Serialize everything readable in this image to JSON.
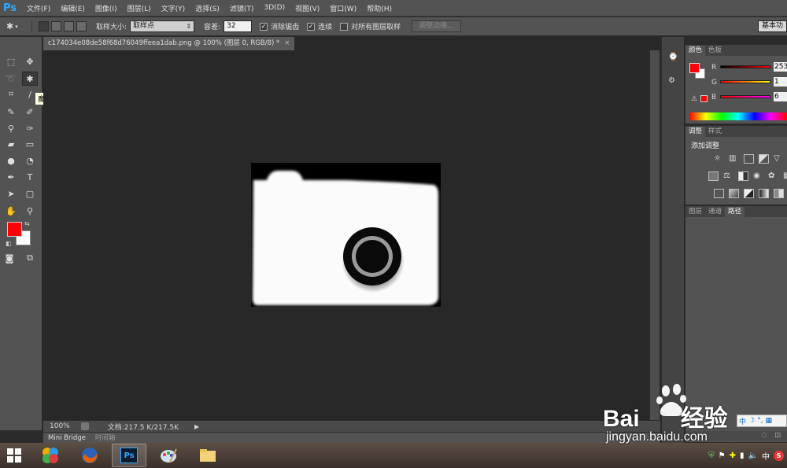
{
  "app": {
    "logo": "Ps"
  },
  "menu": [
    "文件(F)",
    "编辑(E)",
    "图像(I)",
    "图层(L)",
    "文字(Y)",
    "选择(S)",
    "滤镜(T)",
    "3D(D)",
    "视图(V)",
    "窗口(W)",
    "帮助(H)"
  ],
  "options": {
    "sample_size_label": "取样大小:",
    "sample_size_value": "取样点",
    "tolerance_label": "容差:",
    "tolerance_value": "32",
    "antialias_label": "消除锯齿",
    "contiguous_label": "连续",
    "sample_all_label": "对所有图层取样",
    "refine_edge_label": "调整边缘...",
    "workspace_label": "基本功"
  },
  "tooltip": "魔棒工具 (W)",
  "document": {
    "tab_title": "c174034e08de58f68d76049ffeea1dab.png @ 100% (图层 0, RGB/8) *",
    "close": "×",
    "zoom": "100%",
    "doc_size": "文档:217.5 K/217.5K"
  },
  "bottom_tabs": [
    "Mini Bridge",
    "时间轴"
  ],
  "color_panel": {
    "tabs": [
      "颜色",
      "色板"
    ],
    "r_label": "R",
    "g_label": "G",
    "b_label": "B",
    "r_value": "253",
    "g_value": "1",
    "b_value": "6"
  },
  "adjust_panel": {
    "tabs": [
      "调整",
      "样式"
    ],
    "title": "添加调整"
  },
  "layers_panel": {
    "tabs": [
      "图层",
      "通道",
      "路径"
    ]
  },
  "colors": {
    "foreground": "#fd0106",
    "background": "#ffffff"
  },
  "watermark": {
    "brand": "Bai",
    "brand2": "经验",
    "url": "jingyan.baidu.com"
  },
  "tray": {
    "ime": "中",
    "ime2": "中",
    "antivirus": "S"
  }
}
